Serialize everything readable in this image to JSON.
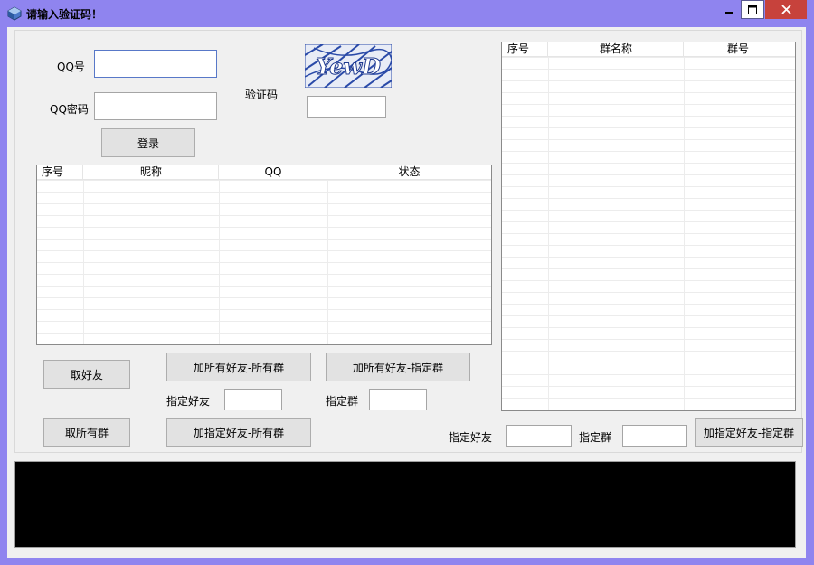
{
  "window": {
    "title": "请输入验证码！"
  },
  "login": {
    "qq_label": "QQ号",
    "qq_value": "",
    "password_label": "QQ密码",
    "password_value": "",
    "captcha_label": "验证码",
    "captcha_text": "YewD",
    "captcha_value": "",
    "login_button": "登录"
  },
  "friends_table": {
    "columns": [
      "序号",
      "昵称",
      "QQ",
      "状态"
    ],
    "rows": []
  },
  "groups_table": {
    "columns": [
      "序号",
      "群名称",
      "群号"
    ],
    "rows": []
  },
  "actions": {
    "get_friends": "取好友",
    "get_all_groups": "取所有群",
    "add_all_friends_all_groups": "加所有好友-所有群",
    "add_all_friends_specified_group": "加所有好友-指定群",
    "add_specified_friend_all_groups": "加指定好友-所有群",
    "add_specified_friend_specified_group": "加指定好友-指定群",
    "specified_friend_label": "指定好友",
    "specified_group_label": "指定群",
    "specified_friend_label_right": "指定好友",
    "specified_group_label_right": "指定群"
  },
  "colors": {
    "title_bar": "#8f84ef",
    "close_button": "#c7423c",
    "console": "#000000"
  },
  "icons": {
    "app": "app-icon",
    "minimize": "minimize-icon",
    "maximize": "maximize-icon",
    "close": "close-icon"
  }
}
